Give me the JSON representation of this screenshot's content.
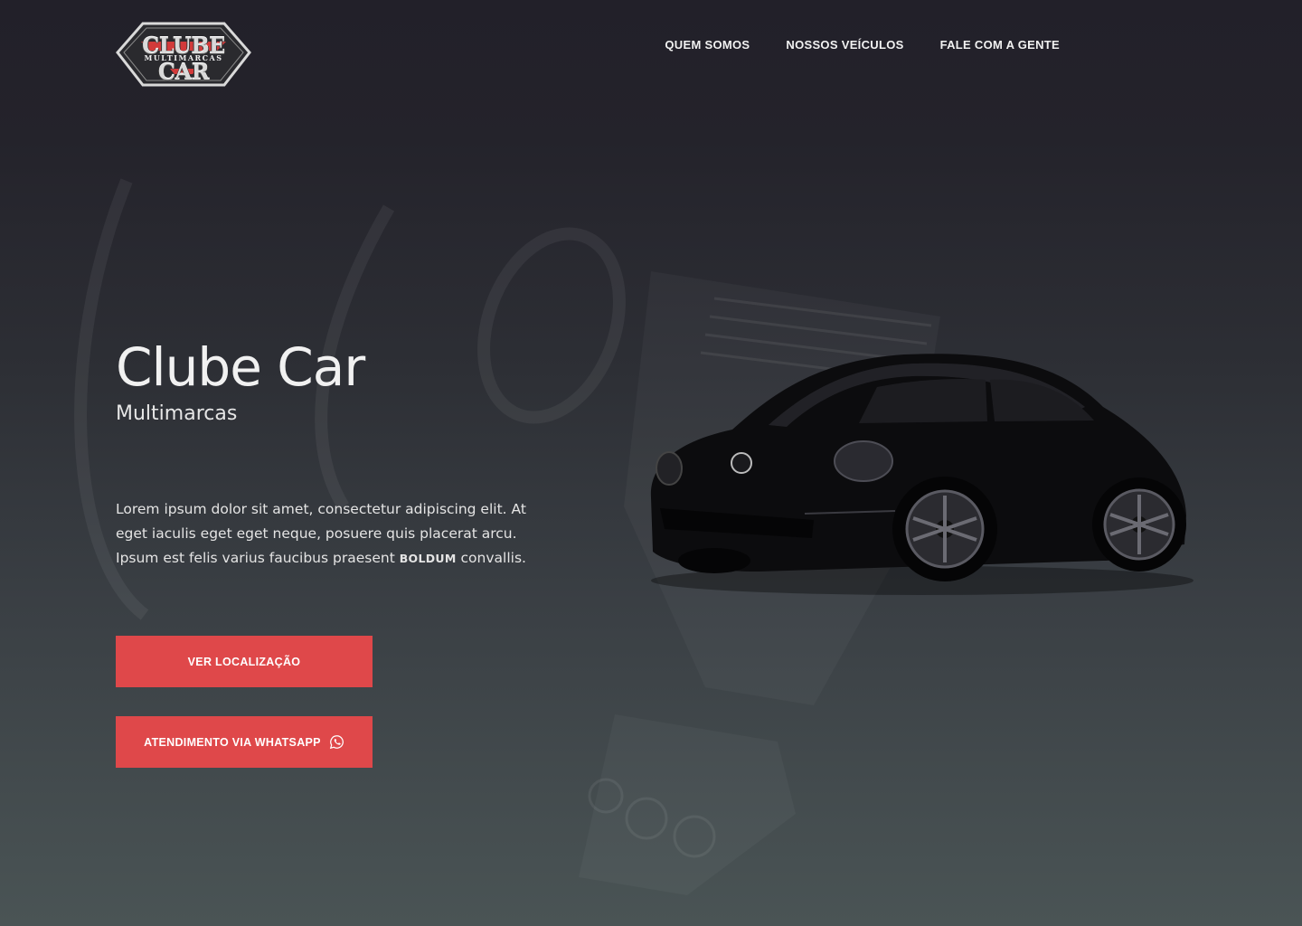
{
  "colors": {
    "accent": "#df484a",
    "background_top": "#222029",
    "background_bottom": "#4a5455",
    "text": "#f1f1f1"
  },
  "logo": {
    "main": "CLUBE CAR",
    "sub": "MULTIMARCAS"
  },
  "nav": {
    "items": [
      {
        "label": "QUEM SOMOS"
      },
      {
        "label": "NOSSOS VEÍCULOS"
      },
      {
        "label": "FALE COM A GENTE"
      }
    ]
  },
  "hero": {
    "title": "Clube Car",
    "subtitle": "Multimarcas",
    "body_before": "Lorem ipsum dolor sit amet, consectetur adipiscing elit. At eget iaculis eget eget neque, posuere quis placerat arcu. Ipsum est felis varius faucibus praesent ",
    "body_bold": "BOLDUM",
    "body_after": " convallis."
  },
  "buttons": {
    "location_label": "VER LOCALIZAÇÃO",
    "whatsapp_label": "ATENDIMENTO VIA WHATSAPP",
    "whatsapp_icon": "whatsapp-icon"
  },
  "images": {
    "hero_car": "black-beetle-car-image",
    "background": "car-interior-dashboard-image"
  }
}
